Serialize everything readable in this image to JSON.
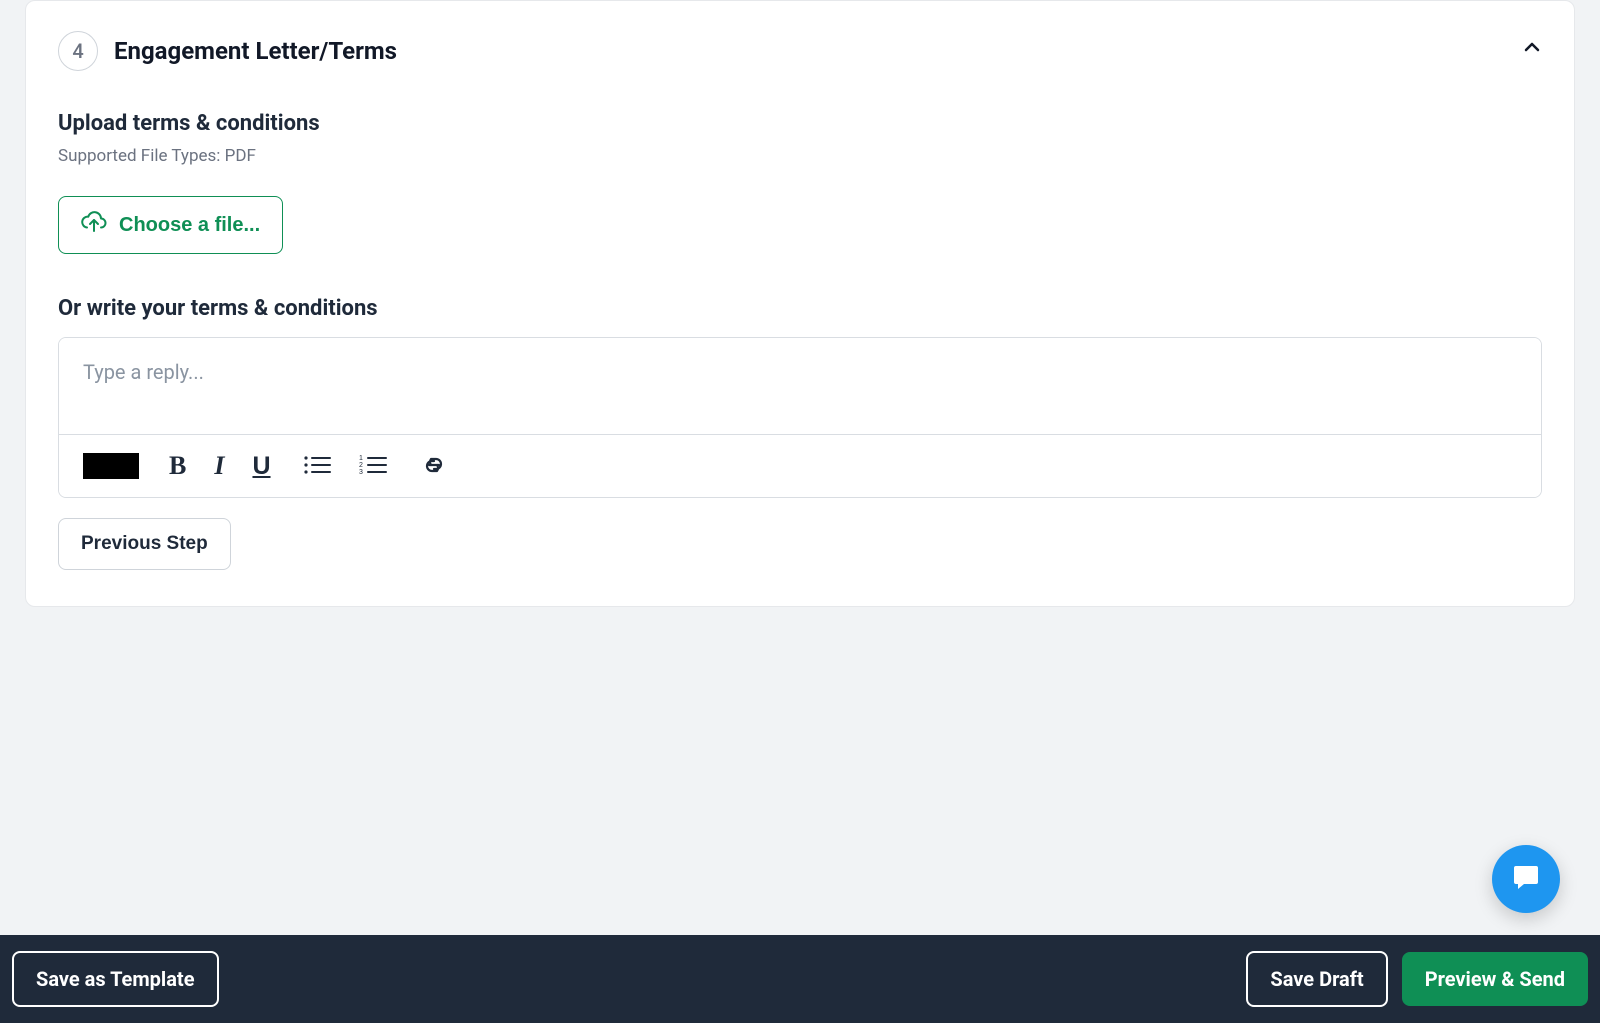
{
  "section": {
    "step_number": "4",
    "title": "Engagement Letter/Terms"
  },
  "upload": {
    "heading": "Upload terms & conditions",
    "supported": "Supported File Types: PDF",
    "choose_file_label": "Choose a file..."
  },
  "write": {
    "heading": "Or write your terms & conditions",
    "placeholder": "Type a reply..."
  },
  "toolbar": {
    "color": "#000000",
    "bold_label": "B",
    "italic_label": "I",
    "underline_label": "U"
  },
  "nav": {
    "previous_step": "Previous Step"
  },
  "footer": {
    "save_template": "Save as Template",
    "save_draft": "Save Draft",
    "preview_send": "Preview & Send"
  },
  "colors": {
    "accent_green": "#0f8f55",
    "footer_bg": "#1f2a3a",
    "chat_blue": "#1E96F0"
  }
}
